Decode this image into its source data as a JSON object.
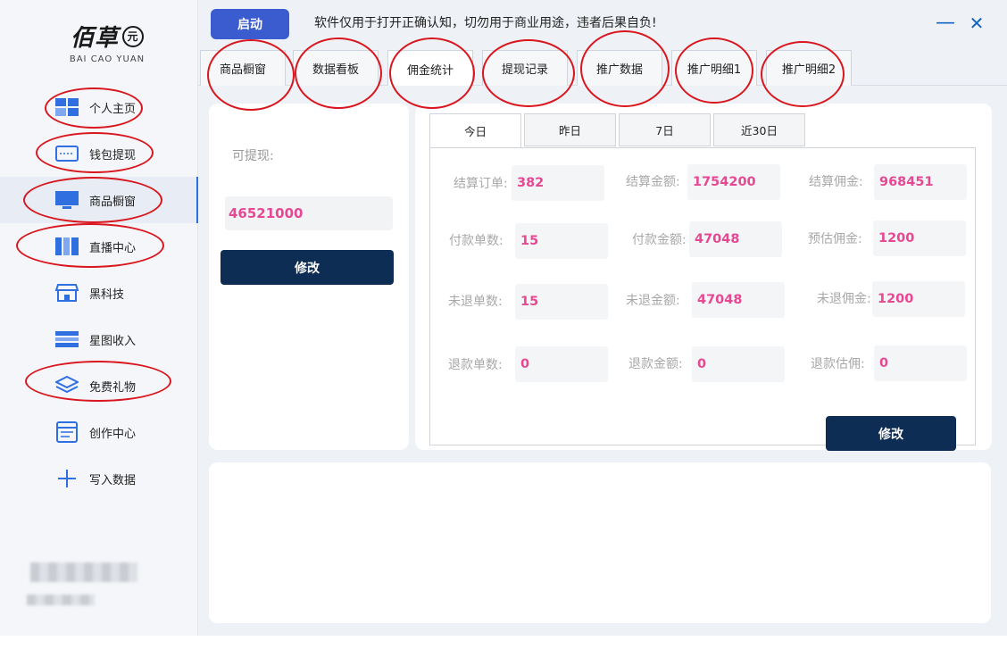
{
  "app": {
    "logo_text": "佰草",
    "logo_seal": "元",
    "logo_sub": "BAI CAO YUAN"
  },
  "sidebar": {
    "items": [
      {
        "label": "个人主页",
        "icon": "grid-icon"
      },
      {
        "label": "钱包提现",
        "icon": "wallet-icon"
      },
      {
        "label": "商品橱窗",
        "icon": "monitor-icon"
      },
      {
        "label": "直播中心",
        "icon": "columns-icon"
      },
      {
        "label": "黑科技",
        "icon": "store-icon"
      },
      {
        "label": "星图收入",
        "icon": "list-icon"
      },
      {
        "label": "免费礼物",
        "icon": "layers-icon"
      },
      {
        "label": "创作中心",
        "icon": "document-icon"
      },
      {
        "label": "写入数据",
        "icon": "plus-icon"
      }
    ],
    "active_index": 2
  },
  "topbar": {
    "start_label": "启动",
    "notice": "软件仅用于打开正确认知，切勿用于商业用途，违者后果自负!",
    "minimize": "—",
    "close": "✕"
  },
  "tabs": [
    {
      "label": "商品橱窗"
    },
    {
      "label": "数据看板"
    },
    {
      "label": "佣金统计"
    },
    {
      "label": "提现记录"
    },
    {
      "label": "推广数据"
    },
    {
      "label": "推广明细1"
    },
    {
      "label": "推广明细2"
    }
  ],
  "active_tab": 2,
  "withdraw": {
    "label": "可提现:",
    "value": "46521000",
    "edit_label": "修改"
  },
  "periods": [
    "今日",
    "昨日",
    "7日",
    "近30日"
  ],
  "active_period": 0,
  "stats": [
    {
      "label": "结算订单:",
      "value": "382"
    },
    {
      "label": "结算金额:",
      "value": "1754200"
    },
    {
      "label": "结算佣金:",
      "value": "968451"
    },
    {
      "label": "付款单数:",
      "value": "15"
    },
    {
      "label": "付款金额:",
      "value": "47048"
    },
    {
      "label": "预估佣金:",
      "value": "1200"
    },
    {
      "label": "未退单数:",
      "value": "15"
    },
    {
      "label": "未退金额:",
      "value": "47048"
    },
    {
      "label": "未退佣金:",
      "value": "1200"
    },
    {
      "label": "退款单数:",
      "value": "0"
    },
    {
      "label": "退款金额:",
      "value": "0"
    },
    {
      "label": "退款估佣:",
      "value": "0"
    }
  ],
  "stats_edit_label": "修改",
  "colors": {
    "accent": "#3b5ccf",
    "navy_button": "#0e2d55",
    "value_pink": "#e74893",
    "annotation_red": "#d9161e",
    "window_controls": "#1565c0"
  }
}
